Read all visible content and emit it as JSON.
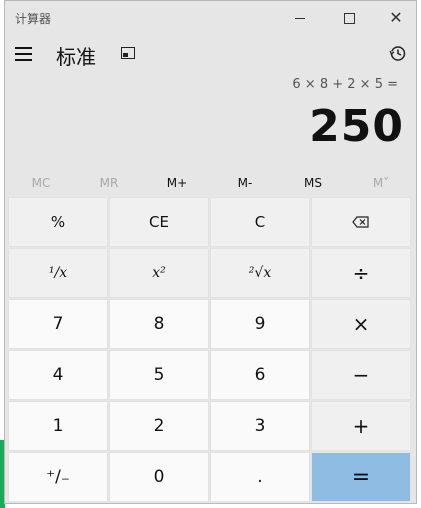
{
  "window": {
    "title": "计算器"
  },
  "header": {
    "mode_title": "标准"
  },
  "display": {
    "expression": "6 × 8 + 2 × 5 =",
    "result": "250"
  },
  "memory": [
    {
      "label": "MC",
      "enabled": false
    },
    {
      "label": "MR",
      "enabled": false
    },
    {
      "label": "M+",
      "enabled": true
    },
    {
      "label": "M-",
      "enabled": true
    },
    {
      "label": "MS",
      "enabled": true
    },
    {
      "label": "M˅",
      "enabled": false
    }
  ],
  "keys": {
    "percent": "%",
    "ce": "CE",
    "clear": "C",
    "reciprocal": "¹/x",
    "square": "x²",
    "sqrt": "²√x",
    "divide": "÷",
    "seven": "7",
    "eight": "8",
    "nine": "9",
    "multiply": "×",
    "four": "4",
    "five": "5",
    "six": "6",
    "minus": "−",
    "one": "1",
    "two": "2",
    "three": "3",
    "plus": "+",
    "negate": "⁺/₋",
    "zero": "0",
    "decimal": ".",
    "equals": "="
  },
  "colors": {
    "window_bg": "#e6e6e6",
    "equals_bg": "#8fbce3",
    "digit_bg": "#fafafa"
  },
  "icons": {
    "menu": "hamburger-icon",
    "keep_on_top": "keep-on-top-icon",
    "history": "history-icon",
    "backspace": "backspace-icon"
  }
}
